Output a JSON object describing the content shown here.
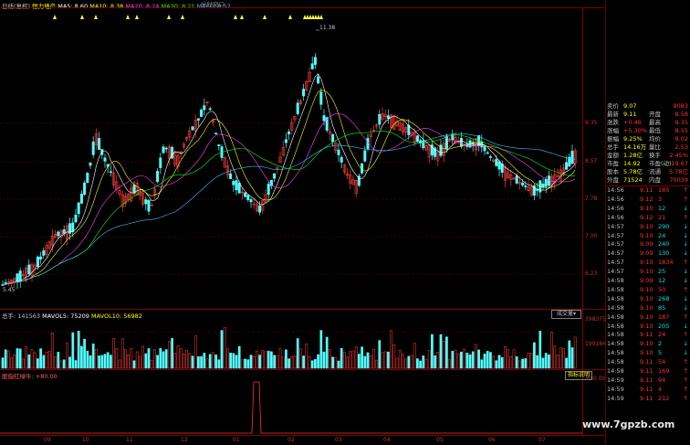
{
  "header": {
    "prefix": "日线(复权)",
    "name": "恒力地产",
    "ma": [
      {
        "label": "MA5: 8.60",
        "color": "#ffffff"
      },
      {
        "label": "MA10: 8.38",
        "color": "#ffff00"
      },
      {
        "label": "MA20: 8.24",
        "color": "#ff40ff"
      },
      {
        "label": "MA30: 8.21",
        "color": "#00ff00"
      },
      {
        "label": "MA60: 8.52",
        "color": "#40c0ff"
      }
    ],
    "right_label": "分时窗口"
  },
  "price_axis": [
    "9.35",
    "8.57",
    "7.78",
    "7.00",
    "6.23"
  ],
  "peak_label": "11.38",
  "low_label": "5.45",
  "volume": {
    "label": "总手: 141563",
    "vmavol5": "MAVOL5: 75209",
    "vmavol10": "MAVOL10: 56982",
    "button": "成交量",
    "axis": [
      "398375",
      "199186"
    ]
  },
  "indicator": {
    "label": "股指红绿牛: +80.00",
    "axis": "+80.00",
    "button": "指标说明"
  },
  "x_ticks": [
    "09",
    "10",
    "11",
    "12",
    "01",
    "02",
    "03",
    "04",
    "05",
    "06",
    "07"
  ],
  "quote": [
    {
      "k": "卖价",
      "v": "9.07",
      "k2": "",
      "v2": "9083"
    },
    {
      "k": "最新",
      "v": "9.11",
      "k2": "开盘",
      "v2": "8.58"
    },
    {
      "k": "涨跌",
      "v": "+0.46",
      "k2": "最高",
      "v2": "9.35"
    },
    {
      "k": "涨幅",
      "v": "+5.30%",
      "k2": "最低",
      "v2": "8.55"
    },
    {
      "k": "振幅",
      "v": "9.25%",
      "k2": "均价",
      "v2": "9.02"
    },
    {
      "k": "总手",
      "v": "14.16万",
      "k2": "量比",
      "v2": "2.53"
    },
    {
      "k": "金额",
      "v": "1.28亿",
      "k2": "换手",
      "v2": "2.45%"
    },
    {
      "k": "市盈",
      "v": "14.92",
      "k2": "市盈(动)",
      "v2": "19.67"
    },
    {
      "k": "股本",
      "v": "5.78亿",
      "k2": "流通",
      "v2": "5.78亿"
    },
    {
      "k": "外盘",
      "v": "71524",
      "k2": "内盘",
      "v2": "70039"
    }
  ],
  "ticks": [
    {
      "t": "14:56",
      "p": "9.11",
      "v": "185",
      "c": "#ff3030"
    },
    {
      "t": "14:56",
      "p": "9.12",
      "v": "3",
      "c": "#ff3030"
    },
    {
      "t": "14:56",
      "p": "9.10",
      "v": "12",
      "c": "#00e0e0"
    },
    {
      "t": "14:56",
      "p": "9.12",
      "v": "21",
      "c": "#ff3030"
    },
    {
      "t": "14:57",
      "p": "9.10",
      "v": "290",
      "c": "#00e0e0"
    },
    {
      "t": "14:57",
      "p": "9.10",
      "v": "24",
      "c": "#00e0e0"
    },
    {
      "t": "14:57",
      "p": "9.09",
      "v": "240",
      "c": "#00e0e0"
    },
    {
      "t": "14:57",
      "p": "9.09",
      "v": "130",
      "c": "#00e0e0"
    },
    {
      "t": "14:57",
      "p": "9.10",
      "v": "1834",
      "c": "#ff3030"
    },
    {
      "t": "14:57",
      "p": "9.10",
      "v": "25",
      "c": "#00e0e0"
    },
    {
      "t": "14:58",
      "p": "9.09",
      "v": "12",
      "c": "#00e0e0"
    },
    {
      "t": "14:58",
      "p": "9.10",
      "v": "50",
      "c": "#ff3030"
    },
    {
      "t": "14:58",
      "p": "9.10",
      "v": "268",
      "c": "#00e0e0"
    },
    {
      "t": "14:58",
      "p": "9.10",
      "v": "85",
      "c": "#00e0e0"
    },
    {
      "t": "14:58",
      "p": "9.10",
      "v": "187",
      "c": "#ff3030"
    },
    {
      "t": "14:58",
      "p": "9.10",
      "v": "205",
      "c": "#00e0e0"
    },
    {
      "t": "14:58",
      "p": "9.11",
      "v": "24",
      "c": "#ff3030"
    },
    {
      "t": "14:58",
      "p": "9.10",
      "v": "2",
      "c": "#00e0e0"
    },
    {
      "t": "14:58",
      "p": "9.10",
      "v": "5",
      "c": "#00e0e0"
    },
    {
      "t": "14:58",
      "p": "9.11",
      "v": "54",
      "c": "#ff3030"
    },
    {
      "t": "14:58",
      "p": "9.11",
      "v": "169",
      "c": "#ff3030"
    },
    {
      "t": "14:59",
      "p": "9.11",
      "v": "94",
      "c": "#ff3030"
    },
    {
      "t": "14:59",
      "p": "9.11",
      "v": "4",
      "c": "#ff3030"
    },
    {
      "t": "14:59",
      "p": "9.11",
      "v": "212",
      "c": "#ff3030"
    }
  ],
  "watermark": "www.7gpzb.com"
}
